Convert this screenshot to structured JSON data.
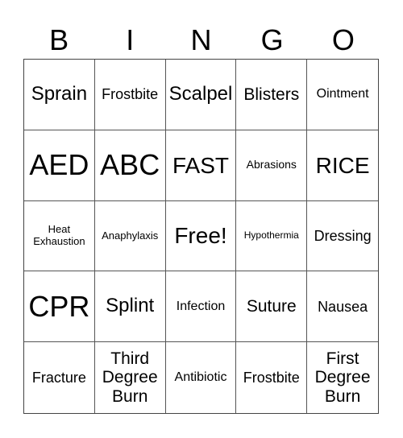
{
  "header": [
    "B",
    "I",
    "N",
    "G",
    "O"
  ],
  "cells": [
    "Sprain",
    "Frostbite",
    "Scalpel",
    "Blisters",
    "Ointment",
    "AED",
    "ABC",
    "FAST",
    "Abrasions",
    "RICE",
    "Heat Exhaustion",
    "Anaphylaxis",
    "Free!",
    "Hypothermia",
    "Dressing",
    "CPR",
    "Splint",
    "Infection",
    "Suture",
    "Nausea",
    "Fracture",
    "Third Degree Burn",
    "Antibiotic",
    "Frostbite",
    "First Degree Burn"
  ]
}
